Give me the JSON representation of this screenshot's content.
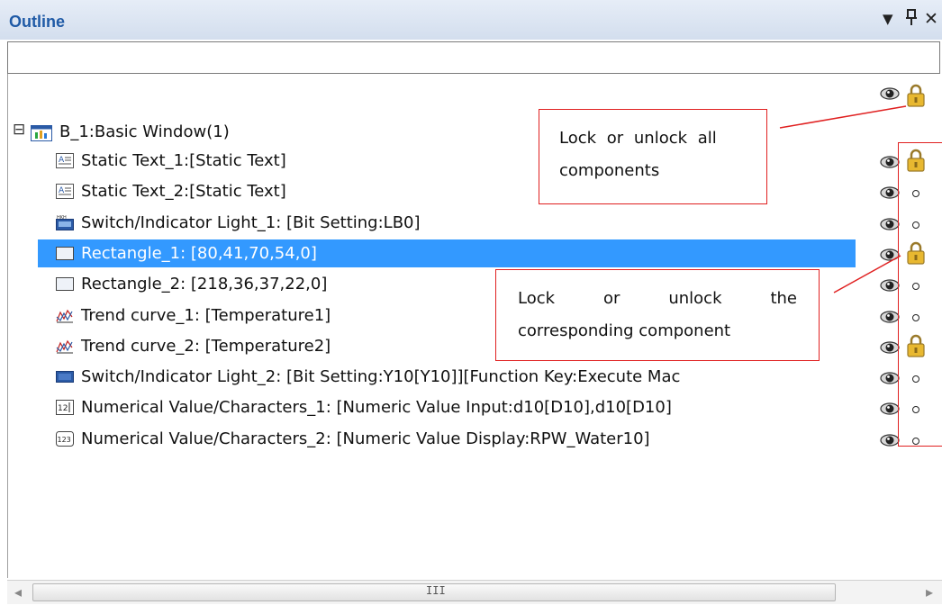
{
  "panel": {
    "title": "Outline",
    "dropdown_glyph": "▼",
    "pin_glyph": "ᛔ",
    "close_glyph": "✕",
    "search_value": ""
  },
  "root": {
    "expander": "⊟",
    "label": "B_1:Basic Window(1)"
  },
  "items": [
    {
      "label": "Static Text_1:[Static Text]",
      "icon": "static-text-icon",
      "locked": true
    },
    {
      "label": "Static Text_2:[Static Text]",
      "icon": "static-text-icon",
      "locked": false
    },
    {
      "label": "Switch/Indicator Light_1: [Bit Setting:LB0]",
      "icon": "switch-indicator-icon",
      "locked": false
    },
    {
      "label": "Rectangle_1: [80,41,70,54,0]",
      "icon": "rectangle-icon",
      "locked": true,
      "selected": true
    },
    {
      "label": "Rectangle_2: [218,36,37,22,0]",
      "icon": "rectangle-icon",
      "locked": false
    },
    {
      "label": "Trend curve_1: [Temperature1]",
      "icon": "trend-curve-icon",
      "locked": false
    },
    {
      "label": "Trend curve_2: [Temperature2]",
      "icon": "trend-curve-icon",
      "locked": true
    },
    {
      "label": "Switch/Indicator Light_2: [Bit Setting:Y10[Y10]][Function Key:Execute Mac",
      "icon": "switch-indicator-2-icon",
      "locked": false
    },
    {
      "label": "Numerical Value/Characters_1: [Numeric Value Input:d10[D10],d10[D10]",
      "icon": "numeric-input-icon",
      "locked": false
    },
    {
      "label": "Numerical Value/Characters_2: [Numeric Value Display:RPW_Water10]",
      "icon": "numeric-display-icon",
      "locked": false
    }
  ],
  "callouts": {
    "lock_all_line1": "Lock or unlock all",
    "lock_all_line2": "components",
    "lock_one_line1_a": "Lock",
    "lock_one_line1_b": "or",
    "lock_one_line1_c": "unlock",
    "lock_one_line1_d": "the",
    "lock_one_line2": "corresponding component"
  },
  "scrollbar": {
    "left_arrow": "◂",
    "grip": "III",
    "right_arrow": "▸"
  },
  "colors": {
    "title": "#1f5aa6",
    "selection": "#3399ff",
    "callout_border": "#e02020",
    "lock_gold": "#e8b830"
  }
}
